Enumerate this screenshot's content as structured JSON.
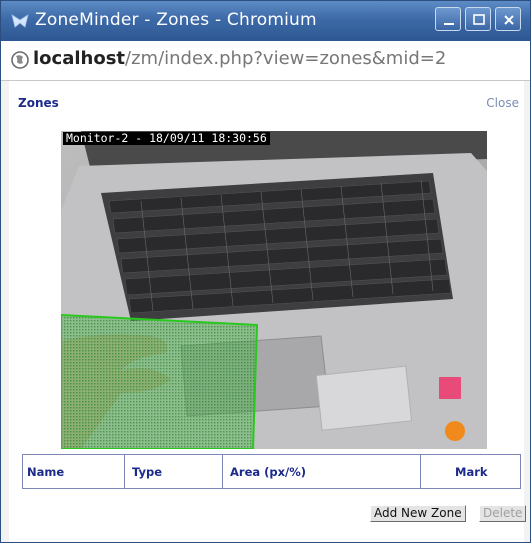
{
  "window": {
    "title": "ZoneMinder - Zones - Chromium",
    "controls": [
      "minimize-icon",
      "maximize-icon",
      "close-icon"
    ]
  },
  "address_bar": {
    "host": "localhost",
    "path": "/zm/index.php?view=zones&mid=2",
    "icon": "globe-icon"
  },
  "page": {
    "heading": "Zones",
    "close_link": "Close"
  },
  "camera": {
    "overlay_text": "Monitor-2 - 18/09/11 18:30:56"
  },
  "zones_table": {
    "columns": [
      "Name",
      "Type",
      "Area (px/%)",
      "Mark"
    ],
    "rows": []
  },
  "buttons": {
    "add_new_zone": "Add New Zone",
    "delete": "Delete"
  },
  "colors": {
    "titlebar": "#3d6aa8",
    "heading": "#1c2a8a",
    "zone_fill": "#3cd23c",
    "zone_border": "#28c81e"
  }
}
